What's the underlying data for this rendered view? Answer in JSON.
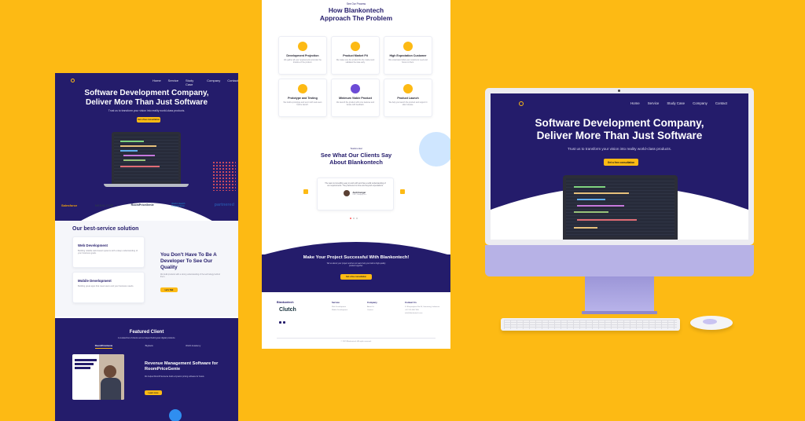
{
  "left_page": {
    "nav": [
      "Home",
      "Service",
      "Study Case",
      "Company",
      "Contact"
    ],
    "hero_title_1": "Software Development Company,",
    "hero_title_2": "Deliver More Than Just Software",
    "hero_subtitle": "Trust us to transform your vision into reality world-class products.",
    "hero_button": "Get a free consultation",
    "logos": [
      "Salesforce",
      "MEDIA.COM",
      "RoomPriceGenie",
      "World Health Organization",
      "partnered"
    ],
    "service_heading": "Our best-service solution",
    "service_cards": [
      {
        "title": "Web Development",
        "text": "Building reliable web-based systems with a deep understanding of your business goals."
      },
      {
        "title": "Mobile Development",
        "text": "Building great apps that meet users and your business needs."
      }
    ],
    "quality_title": "You Don't Have To Be A Developer To See Our Quality",
    "quality_text": "We build products with a strong understanding of the technology behind them.",
    "quality_button": "Let's Talk",
    "featured_title": "Featured Client",
    "featured_subtitle": "A curated list of clients we've helped build great digital products.",
    "featured_tabs": [
      "RoomPriceGenie",
      "Bigbank",
      "WHO Academy"
    ],
    "case_title": "Revenue Management Software for RoomPriceGenie",
    "case_text": "We helped RoomPriceGenie build a dynamic pricing software for hotels.",
    "case_button": "Learn more"
  },
  "middle_page": {
    "process_label": "See Our Process",
    "process_title_1": "How Blankontech",
    "process_title_2": "Approach The Problem",
    "process_cards": [
      {
        "title": "Development Projection",
        "text": "We gather all your requirements and plan the timeline of the product."
      },
      {
        "title": "Product Market Fit",
        "text": "We make sure the product fits the market and validates the idea early."
      },
      {
        "title": "High Expectation Customer",
        "text": "We understand what your customers need and focus on them."
      },
      {
        "title": "Prototype and Testing",
        "text": "We build a prototype and test it with real users before launch."
      },
      {
        "title": "Minimum Viable Product",
        "text": "We launch the product with core features and iterate with feedback."
      },
      {
        "title": "Product Launch",
        "text": "We help you launch the product and support it after release."
      }
    ],
    "testimonial_label": "Testimonial",
    "testimonial_title_1": "See What Our Clients Say",
    "testimonial_title_2": "About Blankontech",
    "testimonial_quote": "The team is incredibly easy to work with and has a solid understanding of our requirements. They delivered on time and beyond expectations.",
    "testimonial_name": "Andi Gunger",
    "testimonial_role": "CEO, Bridgefy Inc.",
    "cta_title": "Make Your Project Successful With Blankontech!",
    "cta_text": "Tell us about your project and let our team help you build a high-quality product together.",
    "cta_button": "Get a free consultation",
    "footer_brand": "Blankontech",
    "footer_clutch": "Clutch",
    "footer_cols": [
      {
        "title": "Service",
        "items": [
          "Web Development",
          "Mobile Development"
        ]
      },
      {
        "title": "Company",
        "items": [
          "About Us",
          "Contact"
        ]
      },
      {
        "title": "Contact Us",
        "items": [
          "Jl. Bhayangkara No.55, Semarang, Indonesia",
          "+62 123 4567 890",
          "info@blankontech.com"
        ]
      }
    ],
    "copyright": "© 2023 Blankontech. All rights reserved."
  },
  "monitor": {
    "nav": [
      "Home",
      "Service",
      "Study Case",
      "Company",
      "Contact"
    ],
    "hero_title_1": "Software Development Company,",
    "hero_title_2": "Deliver More Than Just Software",
    "hero_subtitle": "Trust us to transform your vision into reality world-class products.",
    "hero_button": "Get a free consultation"
  },
  "colors": {
    "background": "#FDBA14",
    "navy": "#241C6B",
    "accent": "#FDBA14",
    "light_blue": "#CFE6FF"
  }
}
